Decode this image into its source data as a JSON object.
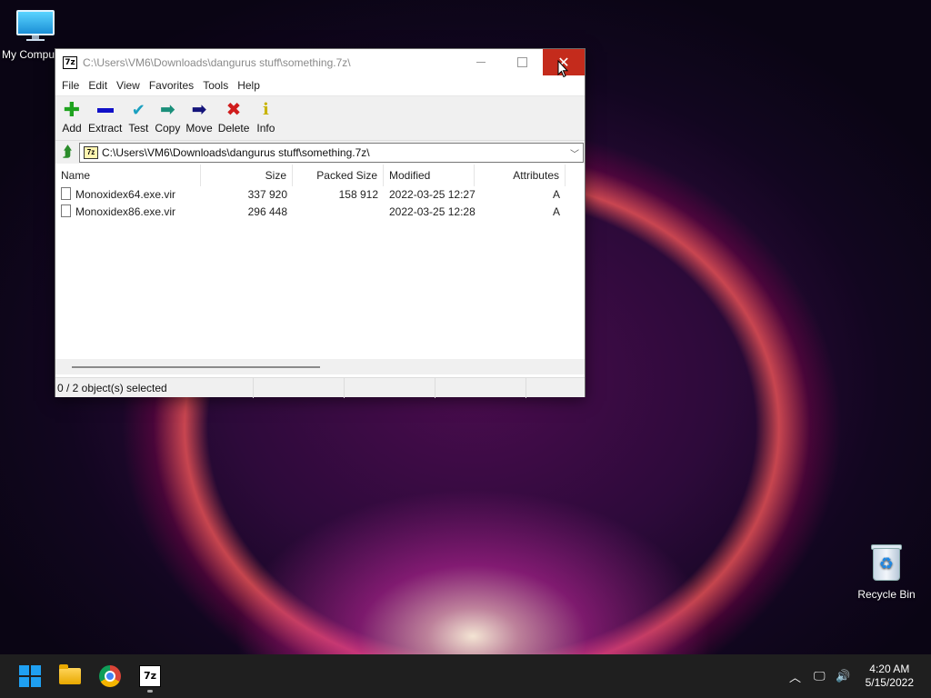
{
  "desktop": {
    "my_computer_label": "My Compu",
    "recycle_bin_label": "Recycle Bin"
  },
  "window": {
    "title": "C:\\Users\\VM6\\Downloads\\dangurus stuff\\something.7z\\",
    "app_icon_text": "7z",
    "menu": [
      "File",
      "Edit",
      "View",
      "Favorites",
      "Tools",
      "Help"
    ],
    "toolbar": [
      {
        "label": "Add",
        "icon": "plus-icon",
        "color": "#1fa31f"
      },
      {
        "label": "Extract",
        "icon": "minus-icon",
        "color": "#1010c8"
      },
      {
        "label": "Test",
        "icon": "check-icon",
        "color": "#1aa0c0"
      },
      {
        "label": "Copy",
        "icon": "arrow-right-icon",
        "color": "#1a8f7a"
      },
      {
        "label": "Move",
        "icon": "arrow-right-icon",
        "color": "#14147a"
      },
      {
        "label": "Delete",
        "icon": "x-icon",
        "color": "#d01c1c"
      },
      {
        "label": "Info",
        "icon": "info-icon",
        "color": "#c8b400"
      }
    ],
    "address": "C:\\Users\\VM6\\Downloads\\dangurus stuff\\something.7z\\",
    "columns": {
      "name": "Name",
      "size": "Size",
      "packed": "Packed Size",
      "modified": "Modified",
      "attributes": "Attributes"
    },
    "files": [
      {
        "name": "Monoxidex64.exe.vir",
        "size": "337 920",
        "packed": "158 912",
        "modified": "2022-03-25 12:27",
        "attributes": "A"
      },
      {
        "name": "Monoxidex86.exe.vir",
        "size": "296 448",
        "packed": "",
        "modified": "2022-03-25 12:28",
        "attributes": "A"
      }
    ],
    "status": "0 / 2 object(s) selected"
  },
  "taskbar": {
    "time": "4:20 AM",
    "date": "5/15/2022",
    "sevenzip_icon_text": "7z"
  }
}
